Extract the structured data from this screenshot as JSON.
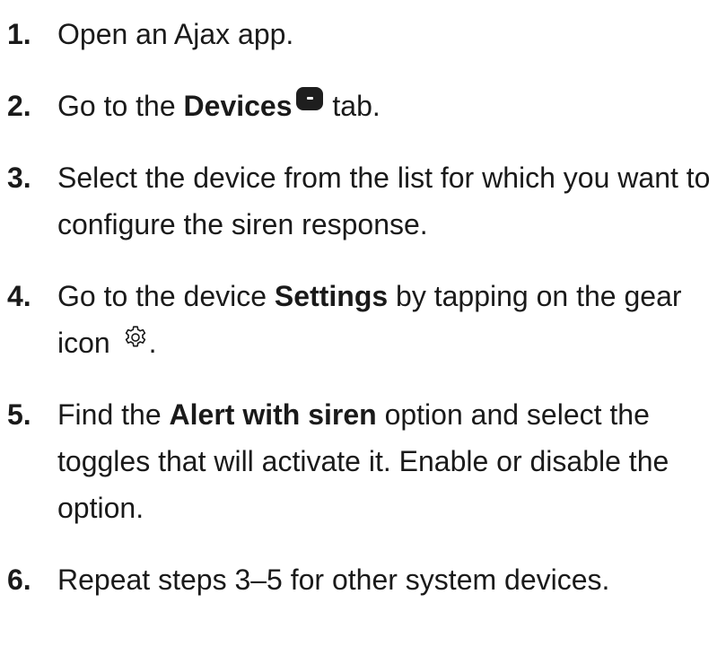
{
  "steps": [
    {
      "number": "1.",
      "text": "Open an Ajax app."
    },
    {
      "number": "2.",
      "pre": "Go to the ",
      "bold": "Devices",
      "post": " tab.",
      "icon": "devices-tab-icon"
    },
    {
      "number": "3.",
      "text": "Select the device from the list for which you want to configure the siren response."
    },
    {
      "number": "4.",
      "pre": "Go to the device ",
      "bold": "Settings",
      "post": " by tapping on the gear icon ",
      "end": ".",
      "icon": "gear-icon"
    },
    {
      "number": "5.",
      "pre": "Find the ",
      "bold": "Alert with siren",
      "post": " option and select the toggles that will activate it. Enable or disable the option."
    },
    {
      "number": "6.",
      "text": "Repeat steps 3–5 for other system devices."
    }
  ]
}
